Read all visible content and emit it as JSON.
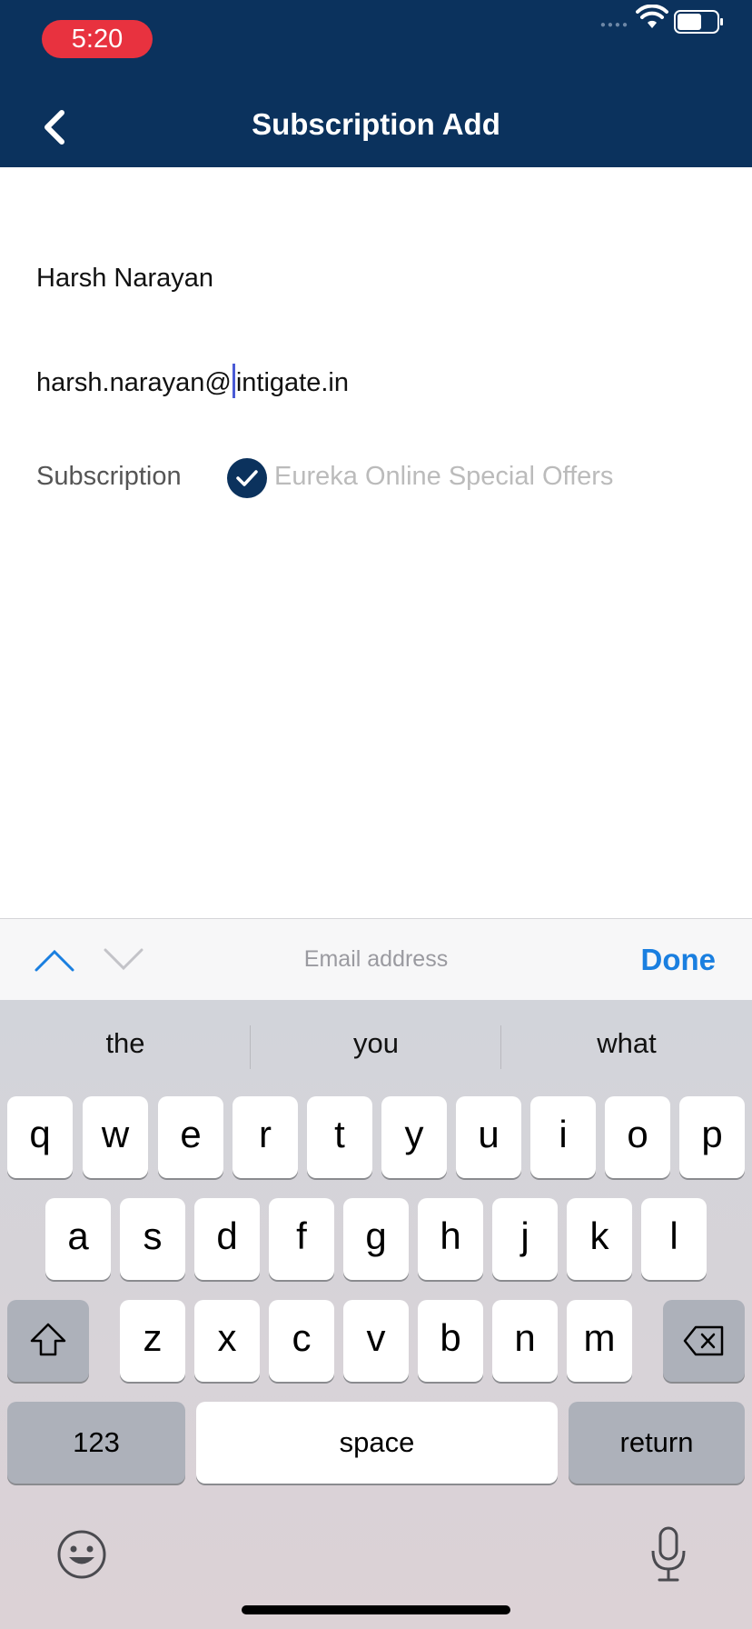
{
  "status_bar": {
    "time": "5:20"
  },
  "header": {
    "title": "Subscription Add",
    "back_icon": "chevron-left-icon"
  },
  "form": {
    "name": "Harsh Narayan",
    "email_before_cursor": "harsh.narayan@",
    "email_after_cursor": "intigate.in",
    "subscription_label": "Subscription",
    "subscription_option": "Eureka Online Special Offers",
    "subscription_checked": true
  },
  "accessory_bar": {
    "field_label": "Email address",
    "done_label": "Done"
  },
  "keyboard": {
    "suggestions": [
      "the",
      "you",
      "what"
    ],
    "row1": [
      "q",
      "w",
      "e",
      "r",
      "t",
      "y",
      "u",
      "i",
      "o",
      "p"
    ],
    "row2": [
      "a",
      "s",
      "d",
      "f",
      "g",
      "h",
      "j",
      "k",
      "l"
    ],
    "row3": [
      "z",
      "x",
      "c",
      "v",
      "b",
      "n",
      "m"
    ],
    "numbers_label": "123",
    "space_label": "space",
    "return_label": "return"
  },
  "colors": {
    "header_bg": "#0b325d",
    "time_pill": "#e8323f",
    "done_blue": "#1a7fe0"
  }
}
